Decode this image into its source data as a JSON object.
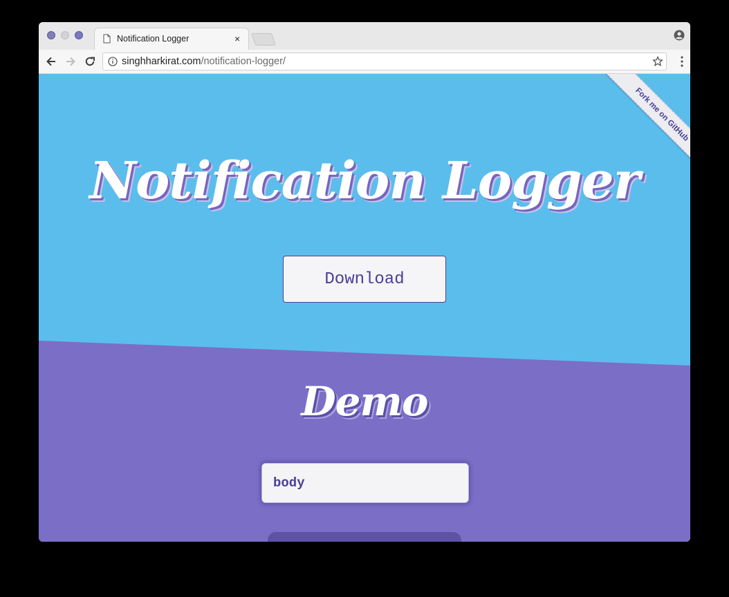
{
  "browser": {
    "tab": {
      "title": "Notification Logger",
      "close_glyph": "×"
    },
    "url": {
      "host": "singhharkirat.com",
      "path": "/notification-logger/"
    },
    "icons": [
      "document-icon",
      "close-icon",
      "new-tab-icon",
      "profile-icon",
      "back-icon",
      "forward-icon",
      "reload-icon",
      "info-icon",
      "star-icon",
      "menu-icon"
    ]
  },
  "page": {
    "ribbon_label": "Fork me on GitHub",
    "title": "Notification Logger",
    "download_label": "Download",
    "demo_heading": "Demo",
    "demo_input_value": "body"
  },
  "colors": {
    "hero_blue": "#5bbdec",
    "demo_purple": "#7b6ec6",
    "accent_text": "#4a4096"
  }
}
